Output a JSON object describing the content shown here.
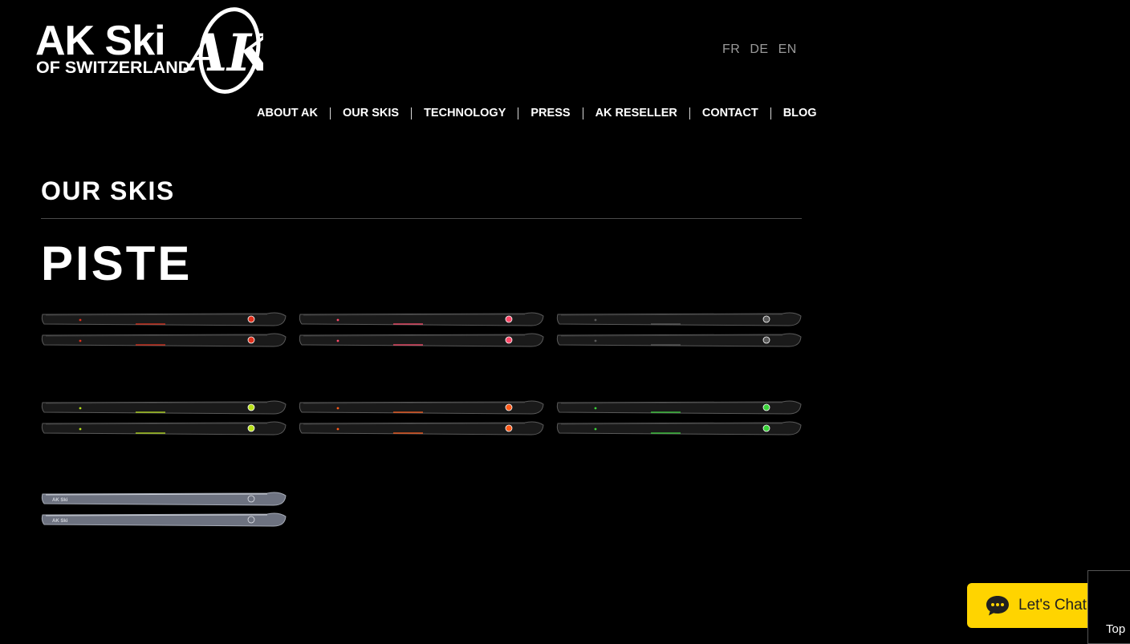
{
  "brand": {
    "wordmark": "AK Ski",
    "tagline": "OF SWITZERLAND",
    "emblem": "AK",
    "logo_color": "#ffffff"
  },
  "languages": [
    "FR",
    "DE",
    "EN"
  ],
  "nav": [
    "ABOUT AK",
    "OUR SKIS",
    "TECHNOLOGY",
    "PRESS",
    "AK RESELLER",
    "CONTACT",
    "BLOG"
  ],
  "page": {
    "section_title": "OUR SKIS",
    "category_title": "PISTE"
  },
  "skis": [
    {
      "name": "ski-red",
      "topsheet": "black",
      "accent": "#e0301c"
    },
    {
      "name": "ski-pink",
      "topsheet": "black",
      "accent": "#ff4a6a"
    },
    {
      "name": "ski-black",
      "topsheet": "black",
      "accent": "#5a5a5a"
    },
    {
      "name": "ski-lime",
      "topsheet": "black",
      "accent": "#b8e01a"
    },
    {
      "name": "ski-orange",
      "topsheet": "black",
      "accent": "#ff5a1a"
    },
    {
      "name": "ski-green",
      "topsheet": "black",
      "accent": "#3ad23a"
    },
    {
      "name": "ski-silver",
      "topsheet": "silver",
      "accent": "#9aa0ac",
      "label": "AK Ski"
    }
  ],
  "chat": {
    "label": "Let's Chat!",
    "icon": "chat-bubble-icon",
    "color": "#ffd400"
  },
  "back_to_top": {
    "label": "Top"
  }
}
